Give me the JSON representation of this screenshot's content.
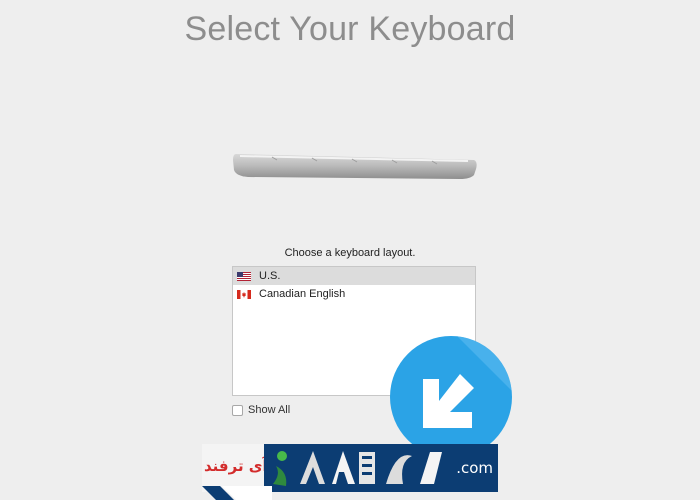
{
  "header": {
    "title": "Select Your Keyboard"
  },
  "content": {
    "prompt": "Choose a keyboard layout.",
    "layouts": [
      {
        "label": "U.S.",
        "flag": "us-flag-icon",
        "selected": true
      },
      {
        "label": "Canadian English",
        "flag": "canada-flag-icon",
        "selected": false
      }
    ],
    "show_all_label": "Show All",
    "show_all_checked": false
  },
  "overlay": {
    "arrow_icon": "arrow-down-left-icon",
    "watermark_left": "آی ترفند",
    "watermark_right": ".com",
    "accent_color": "#2ba3e6"
  }
}
